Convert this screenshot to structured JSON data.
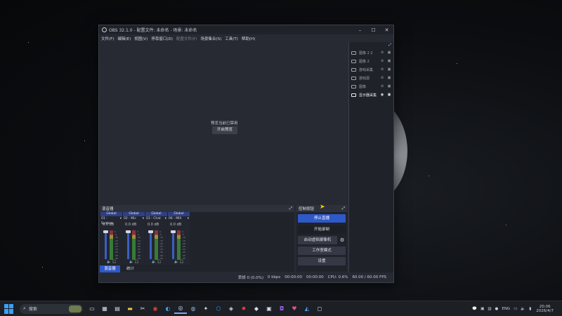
{
  "window": {
    "title": "OBS 32.1.0 - 配置文件: 未命名 - 场景: 未命名",
    "controls": [
      "–",
      "☐",
      "✕"
    ]
  },
  "menu": [
    "文件(F)",
    "编辑(E)",
    "视图(V)",
    "停靠窗口(D)",
    "配置文件(P)",
    "场景集合(S)",
    "工具(T)",
    "帮助(H)"
  ],
  "preview": {
    "message": "预览当前已禁用",
    "button": "开启预览"
  },
  "sources": {
    "header": "",
    "items": [
      {
        "name": "图像 2 2",
        "type": "image"
      },
      {
        "name": "图像 2",
        "type": "image"
      },
      {
        "name": "游戏采集",
        "type": "game"
      },
      {
        "name": "游戏源",
        "type": "game"
      },
      {
        "name": "图像",
        "type": "image"
      },
      {
        "name": "显示器采集",
        "type": "display"
      }
    ]
  },
  "mixer": {
    "title": "混音器",
    "channels": [
      {
        "global": "Global",
        "name": "01 - System",
        "db": "0.0 dB"
      },
      {
        "global": "Global",
        "name": "02 - Mic",
        "db": "0.0 dB"
      },
      {
        "global": "Global",
        "name": "03 - Chat",
        "db": "0.0 dB"
      },
      {
        "global": "Global",
        "name": "06 - MIX",
        "db": "0.0 dB"
      }
    ],
    "scale": [
      "0",
      "-5",
      "-10",
      "-15",
      "-20",
      "-25",
      "-30",
      "-35",
      "-40",
      "-45",
      "-50",
      "-60"
    ],
    "tabs": [
      "混音器",
      "统计"
    ]
  },
  "controls": {
    "title": "控制按钮",
    "stream": "停止直播",
    "record": "开始录制",
    "virtualcam": "启动虚拟摄像机",
    "studio": "工作室模式",
    "settings": "设置"
  },
  "status": {
    "dropped": "丢帧 0 (0.0%)",
    "bitrate": "0 kbps",
    "stream_time": "00:00:00",
    "rec_time": "00:00:00",
    "cpu": "CPU: 0.6%",
    "fps": "60.00 / 60.00 FPS"
  },
  "taskbar": {
    "search": "搜索",
    "lang": "ENG",
    "time": "20:06",
    "date": "2026/4/7"
  }
}
